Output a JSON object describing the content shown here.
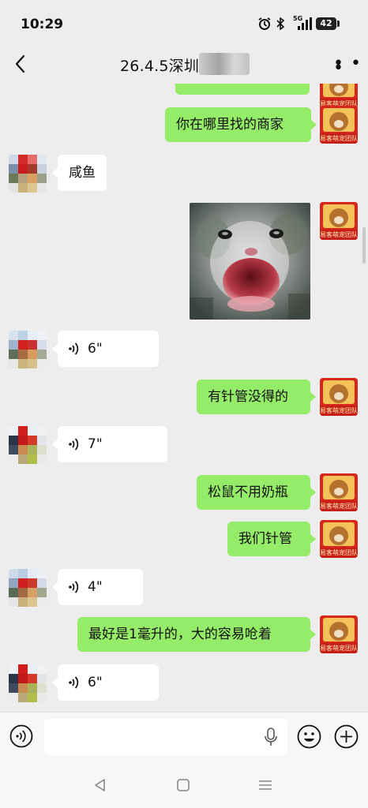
{
  "status_bar": {
    "time": "10:29",
    "network": "5G",
    "battery": "42"
  },
  "header": {
    "title": "26.4.5深圳",
    "back_icon": "chevron-left-icon",
    "more_icon": "more-dots-icon"
  },
  "avatar_me": {
    "badge_text": "易客萌宠团队"
  },
  "messages": [
    {
      "id": 0,
      "sender": "me",
      "type": "text",
      "text": ""
    },
    {
      "id": 1,
      "sender": "me",
      "type": "text",
      "text": "你在哪里找的商家"
    },
    {
      "id": 2,
      "sender": "them",
      "type": "text",
      "text": "咸鱼"
    },
    {
      "id": 3,
      "sender": "me",
      "type": "image",
      "alt": "screaming-cat-image"
    },
    {
      "id": 4,
      "sender": "them",
      "type": "voice",
      "duration": "6\""
    },
    {
      "id": 5,
      "sender": "me",
      "type": "text",
      "text": "有针管没得的"
    },
    {
      "id": 6,
      "sender": "them",
      "type": "voice",
      "duration": "7\""
    },
    {
      "id": 7,
      "sender": "me",
      "type": "text",
      "text": "松鼠不用奶瓶"
    },
    {
      "id": 8,
      "sender": "me",
      "type": "text",
      "text": "我们针管"
    },
    {
      "id": 9,
      "sender": "them",
      "type": "voice",
      "duration": "4\""
    },
    {
      "id": 10,
      "sender": "me",
      "type": "text",
      "text": "最好是1毫升的，大的容易呛着"
    },
    {
      "id": 11,
      "sender": "them",
      "type": "voice",
      "duration": "6\""
    }
  ],
  "input_bar": {
    "placeholder": "",
    "value": "",
    "voice_icon": "voice-mode-icon",
    "mic_icon": "microphone-icon",
    "emoji_icon": "emoji-icon",
    "plus_icon": "plus-icon"
  },
  "nav_bar": {
    "back_icon": "nav-back-icon",
    "home_icon": "nav-home-icon",
    "recents_icon": "nav-recents-icon"
  },
  "colors": {
    "my_bubble": "#95ec69",
    "their_bubble": "#ffffff",
    "background": "#ededed"
  }
}
